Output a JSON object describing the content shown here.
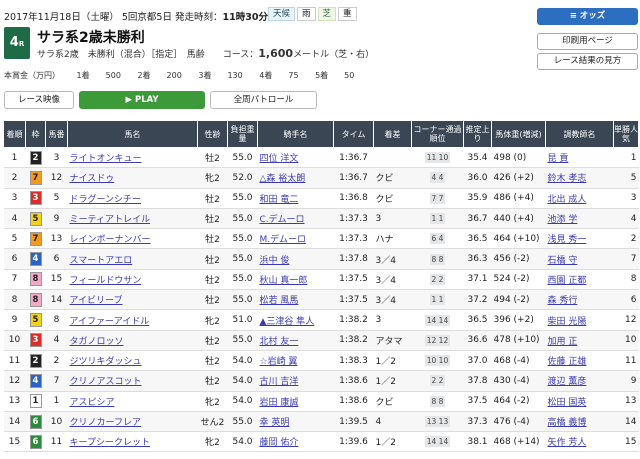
{
  "race": {
    "date": "2017年11月18日（土曜）",
    "meeting": "5回京都5日",
    "start_label": "発走時刻：",
    "start_time": "11時30分",
    "weather_label": "天候",
    "weather": "雨",
    "surface_label": "芝",
    "going": "重",
    "number": "4",
    "number_suffix": "R",
    "name": "サラ系2歳未勝利",
    "conditions": "サラ系2歳　未勝利（混合）［指定］　馬齢　　コース：",
    "distance": "1,600",
    "distance_unit": "メートル（芝・右）",
    "prize_label": "本賞金（万円）",
    "prizes": [
      "1着　　500",
      "2着　　200",
      "3着　　130",
      "4着　　75",
      "5着　　50"
    ]
  },
  "actions": {
    "odds": "≡ オッズ",
    "print": "印刷用ページ",
    "howto": "レース結果の見方"
  },
  "video": {
    "race": "レース映像",
    "play": "▶ PLAY",
    "patrol": "全周パトロール"
  },
  "columns": [
    "着順",
    "枠",
    "馬番",
    "馬名",
    "性齢",
    "負担重量",
    "騎手名",
    "タイム",
    "着差",
    "コーナー通過順位",
    "推定上り",
    "馬体重(増減)",
    "調教師名",
    "単勝人気"
  ],
  "waku_colors": {
    "1": [
      "#ffffff",
      "#222222"
    ],
    "2": [
      "#222222",
      "#ffffff"
    ],
    "3": [
      "#e02b2b",
      "#ffffff"
    ],
    "4": [
      "#2a62c8",
      "#ffffff"
    ],
    "5": [
      "#f2d21a",
      "#222222"
    ],
    "6": [
      "#2e8a3b",
      "#ffffff"
    ],
    "7": [
      "#f39a1a",
      "#222222"
    ],
    "8": [
      "#f3a9c4",
      "#222222"
    ]
  },
  "rows": [
    [
      "1",
      "2",
      "3",
      "ライトオンキュー",
      "牡2",
      "55.0",
      "四位 洋文",
      "1:36.7",
      "",
      "11 10",
      "35.4",
      "498 (0)",
      "昆 貢",
      "1"
    ],
    [
      "2",
      "7",
      "12",
      "ナイスドゥ",
      "牝2",
      "52.0",
      "△森 裕太朗",
      "1:36.7",
      "クビ",
      "4 4",
      "36.0",
      "426 (+2)",
      "鈴木 孝志",
      "5"
    ],
    [
      "3",
      "3",
      "5",
      "ドラグーンシチー",
      "牡2",
      "55.0",
      "和田 竜二",
      "1:36.8",
      "クビ",
      "7 7",
      "35.9",
      "486 (+4)",
      "北出 成人",
      "3"
    ],
    [
      "4",
      "5",
      "9",
      "ミーティアトレイル",
      "牡2",
      "55.0",
      "C.デムーロ",
      "1:37.3",
      "3",
      "1 1",
      "36.7",
      "440 (+4)",
      "池添 学",
      "4"
    ],
    [
      "5",
      "7",
      "13",
      "レインボーナンバー",
      "牡2",
      "55.0",
      "M.デムーロ",
      "1:37.3",
      "ハナ",
      "6 4",
      "36.5",
      "464 (+10)",
      "浅見 秀一",
      "2"
    ],
    [
      "6",
      "4",
      "6",
      "スマートアエロ",
      "牡2",
      "55.0",
      "浜中 俊",
      "1:37.8",
      "3／4",
      "8 8",
      "36.3",
      "456 (-2)",
      "石橋 守",
      "7"
    ],
    [
      "7",
      "8",
      "15",
      "フィールドウサン",
      "牡2",
      "55.0",
      "秋山 真一郎",
      "1:37.5",
      "3／4",
      "2 2",
      "37.1",
      "524 (-2)",
      "西園 正都",
      "8"
    ],
    [
      "8",
      "8",
      "14",
      "アイビリーブ",
      "牡2",
      "55.0",
      "松若 風馬",
      "1:37.5",
      "3／4",
      "1 1",
      "37.2",
      "494 (-2)",
      "森 秀行",
      "6"
    ],
    [
      "9",
      "5",
      "8",
      "アイファーアイドル",
      "牝2",
      "51.0",
      "▲三津谷 隼人",
      "1:38.2",
      "3",
      "14 14",
      "36.5",
      "396 (+2)",
      "柴田 光陽",
      "12"
    ],
    [
      "10",
      "3",
      "4",
      "タガノロッソ",
      "牡2",
      "55.0",
      "北村 友一",
      "1:38.2",
      "アタマ",
      "12 12",
      "36.6",
      "478 (+10)",
      "加用 正",
      "10"
    ],
    [
      "11",
      "2",
      "2",
      "ジツリキダッシュ",
      "牡2",
      "54.0",
      "☆岩崎 翼",
      "1:38.3",
      "1／2",
      "10 10",
      "37.0",
      "468 (-4)",
      "佐藤 正雄",
      "11"
    ],
    [
      "12",
      "4",
      "7",
      "クリノアスコット",
      "牡2",
      "54.0",
      "古川 吉洋",
      "1:38.6",
      "1／2",
      "2 2",
      "37.8",
      "430 (-4)",
      "渡辺 薫彦",
      "9"
    ],
    [
      "13",
      "1",
      "1",
      "アスピシア",
      "牝2",
      "54.0",
      "岩田 康誠",
      "1:38.6",
      "クビ",
      "8 8",
      "37.5",
      "464 (-2)",
      "松田 国英",
      "13"
    ],
    [
      "14",
      "6",
      "10",
      "クリノカーフレア",
      "せん2",
      "55.0",
      "幸 英明",
      "1:39.5",
      "4",
      "13 13",
      "37.3",
      "476 (-4)",
      "高橋 義博",
      "14"
    ],
    [
      "15",
      "6",
      "11",
      "キープシークレット",
      "牝2",
      "54.0",
      "藤岡 佑介",
      "1:39.6",
      "1／2",
      "14 14",
      "38.1",
      "468 (+14)",
      "矢作 芳人",
      "15"
    ]
  ]
}
